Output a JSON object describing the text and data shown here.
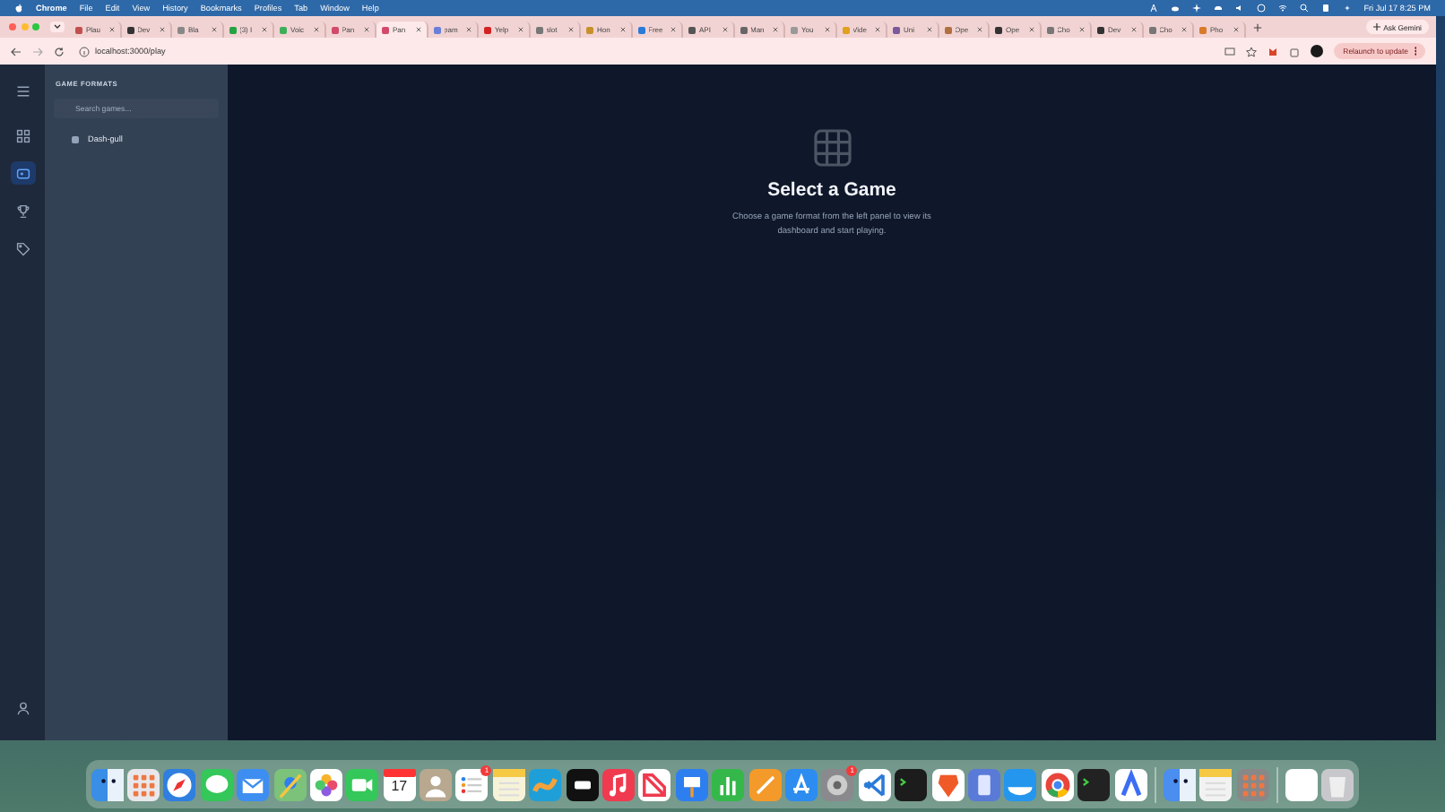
{
  "menu_bar": {
    "app": "Chrome",
    "items": [
      "File",
      "Edit",
      "View",
      "History",
      "Bookmarks",
      "Profiles",
      "Tab",
      "Window",
      "Help"
    ],
    "clock": "Fri Jul 17  8:25 PM"
  },
  "tabs": [
    {
      "title": "Plau",
      "selected": false,
      "color": "#c0504d"
    },
    {
      "title": "Dev",
      "selected": false,
      "color": "#333333"
    },
    {
      "title": "Bla",
      "selected": false,
      "color": "#888888"
    },
    {
      "title": "(3) I",
      "selected": false,
      "color": "#25a244"
    },
    {
      "title": "Voic",
      "selected": false,
      "color": "#3fae5a"
    },
    {
      "title": "Pan",
      "selected": false,
      "color": "#d24a6a"
    },
    {
      "title": "Pan",
      "selected": true,
      "color": "#d24a6a"
    },
    {
      "title": "pam",
      "selected": false,
      "color": "#6a7fd8"
    },
    {
      "title": "Yelp",
      "selected": false,
      "color": "#d32323"
    },
    {
      "title": "slot",
      "selected": false,
      "color": "#777777"
    },
    {
      "title": "Hon",
      "selected": false,
      "color": "#c8902a"
    },
    {
      "title": "Free",
      "selected": false,
      "color": "#2a7ad8"
    },
    {
      "title": "API",
      "selected": false,
      "color": "#555555"
    },
    {
      "title": "Man",
      "selected": false,
      "color": "#666666"
    },
    {
      "title": "You",
      "selected": false,
      "color": "#999999"
    },
    {
      "title": "Vide",
      "selected": false,
      "color": "#e0a020"
    },
    {
      "title": "Uni",
      "selected": false,
      "color": "#7a5a9a"
    },
    {
      "title": "Ope",
      "selected": false,
      "color": "#b07040"
    },
    {
      "title": "Ope",
      "selected": false,
      "color": "#333333"
    },
    {
      "title": "Cho",
      "selected": false,
      "color": "#777777"
    },
    {
      "title": "Dev",
      "selected": false,
      "color": "#333333"
    },
    {
      "title": "Cho",
      "selected": false,
      "color": "#777777"
    },
    {
      "title": "Pho",
      "selected": false,
      "color": "#d87a2a"
    }
  ],
  "gemini_button": "Ask Gemini",
  "address": "localhost:3000/play",
  "relaunch_button": "Relaunch to update",
  "nav": [
    {
      "kind": "dashboard",
      "selected": false
    },
    {
      "kind": "games",
      "selected": true
    },
    {
      "kind": "trophy",
      "selected": false
    },
    {
      "kind": "tag",
      "selected": false
    }
  ],
  "sidebar": {
    "heading": "GAME FORMATS",
    "search": {
      "placeholder": "Search games..."
    },
    "items": [
      {
        "label": "Dash-gull",
        "selected": false
      }
    ]
  },
  "empty_state": {
    "title": "Select a Game",
    "message": "Choose a game format from the left panel to view its dashboard and start playing."
  },
  "dock": {
    "calendar_day": "17",
    "reminders_badge": "1",
    "settings_badge": "1"
  }
}
